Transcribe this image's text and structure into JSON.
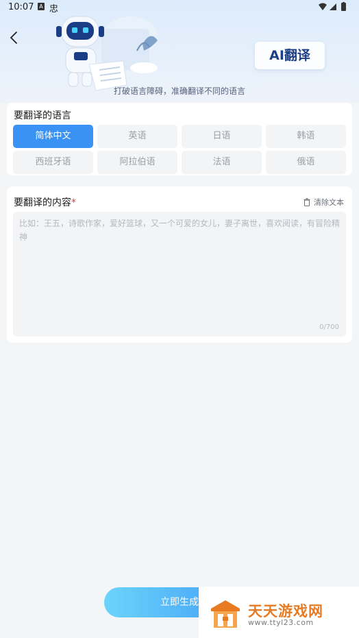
{
  "status_bar": {
    "time": "10:07",
    "a_badge": "A",
    "bug_glyph": "忠"
  },
  "header": {
    "title": "AI翻译",
    "tagline": "打破语言障碍，准确翻译不同的语言"
  },
  "language_section": {
    "title": "要翻译的语言",
    "options": [
      "简体中文",
      "英语",
      "日语",
      "韩语",
      "西班牙语",
      "阿拉伯语",
      "法语",
      "俄语"
    ],
    "selected": "简体中文"
  },
  "content_section": {
    "title": "要翻译的内容",
    "required_mark": "*",
    "clear_label": "清除文本",
    "placeholder": "比如：王五，诗歌作家，爱好篮球，又一个可爱的女儿，妻子离世，喜欢阅读，有冒险精神",
    "counter": "0/700"
  },
  "generate_button": {
    "label": "立即生成"
  },
  "watermark": {
    "title": "天天游戏网",
    "url": "www.ttyl23.com"
  },
  "colors": {
    "accent": "#3a93f4",
    "title_text": "#1c3e86",
    "watermark": "#e87b22"
  }
}
